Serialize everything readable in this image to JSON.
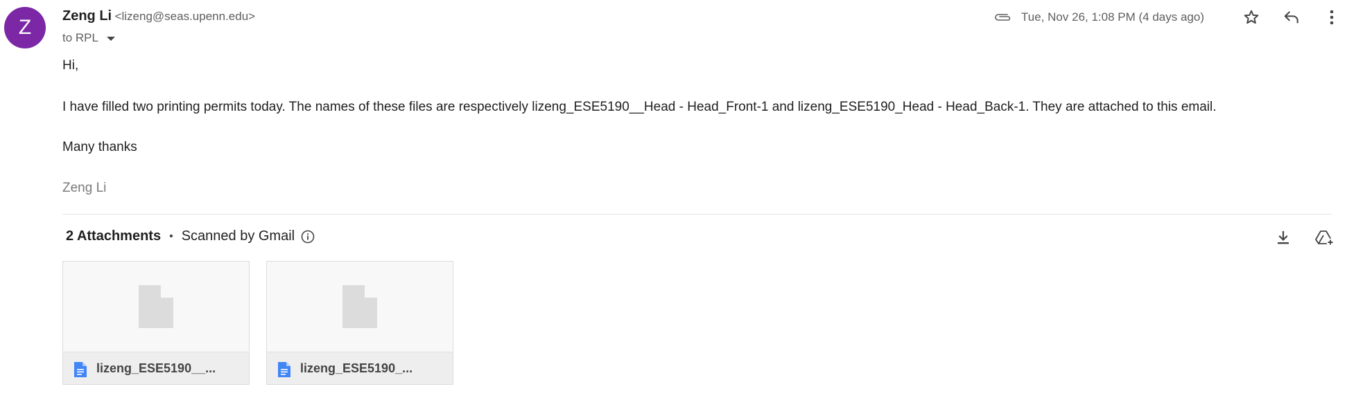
{
  "sender": {
    "avatar_letter": "Z",
    "avatar_color": "#7b27a6",
    "name": "Zeng Li",
    "email": "<lizeng@seas.upenn.edu>"
  },
  "recipients_label": "to RPL",
  "date": "Tue, Nov 26, 1:08 PM (4 days ago)",
  "icons": {
    "attachment": "paperclip-icon",
    "star": "star-icon",
    "reply": "reply-icon",
    "more": "more-vert-icon",
    "download_all": "download-icon",
    "add_to_drive": "add-to-drive-icon",
    "info": "info-icon",
    "file": "document-icon"
  },
  "body": {
    "greeting": "Hi,",
    "paragraph": "I have filled two printing permits today. The names of these files are respectively lizeng_ESE5190__Head - Head_Front-1 and lizeng_ESE5190_Head - Head_Back-1. They are attached to this email.",
    "closing": "Many thanks",
    "signature": "Zeng Li"
  },
  "attachments": {
    "count_label": "2 Attachments",
    "separator": "•",
    "scanned_label": "Scanned by Gmail",
    "files": [
      {
        "name": "lizeng_ESE5190__..."
      },
      {
        "name": "lizeng_ESE5190_..."
      }
    ]
  },
  "colors": {
    "file_icon_blue": "#4285f4",
    "placeholder_gray": "#dcdcdc",
    "text_primary": "#1f1f1f",
    "text_secondary": "#5e5e5e"
  }
}
